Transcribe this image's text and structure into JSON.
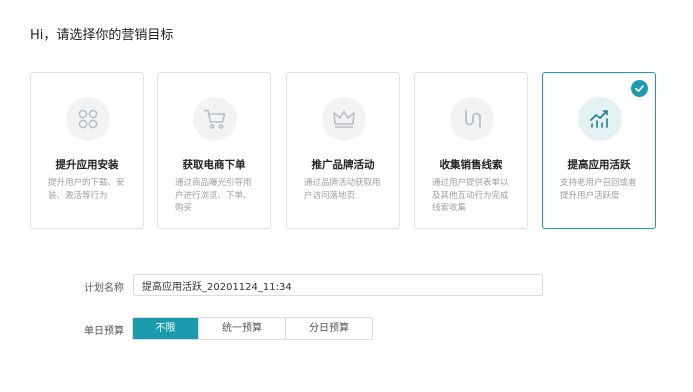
{
  "heading": "Hi，请选择你的营销目标",
  "accent_color": "#1b9aae",
  "cards": [
    {
      "icon": "app-grid-icon",
      "title": "提升应用安装",
      "desc": "提升用户的下载、安装、激活等行为",
      "selected": false
    },
    {
      "icon": "shopping-cart-icon",
      "title": "获取电商下单",
      "desc": "通过商品曝光引导用户进行浏览、下单、购买",
      "selected": false
    },
    {
      "icon": "crown-icon",
      "title": "推广品牌活动",
      "desc": "通过品牌活动获取用户访问落地页",
      "selected": false
    },
    {
      "icon": "route-icon",
      "title": "收集销售线索",
      "desc": "通过用户提供表单以及其他互动行为完成线索收集",
      "selected": false
    },
    {
      "icon": "trend-chart-icon",
      "title": "提高应用活跃",
      "desc": "支持老用户召回或者提升用户活跃度",
      "selected": true
    }
  ],
  "plan_name": {
    "label": "计划名称",
    "value": "提高应用活跃_20201124_11:34"
  },
  "daily_budget": {
    "label": "单日预算",
    "options": [
      "不限",
      "统一预算",
      "分日预算"
    ],
    "selected": "不限"
  }
}
